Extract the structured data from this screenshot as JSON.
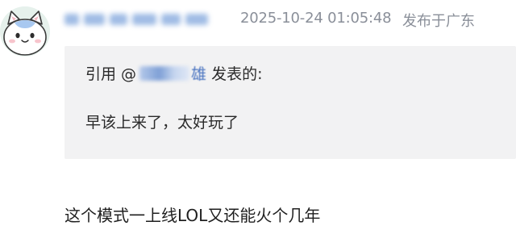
{
  "post": {
    "username": "",
    "timestamp": "2025-10-24 01:05:48",
    "location": "发布于广东"
  },
  "quote": {
    "prefix": "引用 @",
    "user_suffix": "雄",
    "suffix": "发表的:",
    "text": "早该上来了，太好玩了"
  },
  "reply": {
    "text": "这个模式一上线LOL又还能火个几年"
  },
  "colors": {
    "meta_gray": "#8a8f99",
    "link_blue": "#4a74c0",
    "quote_bg": "#f2f2f3"
  }
}
